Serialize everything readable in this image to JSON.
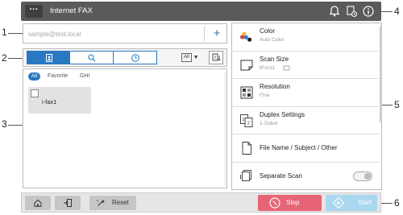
{
  "header": {
    "menu_label": "···",
    "title": "Internet FAX",
    "icons": [
      "bell-icon",
      "job-status-icon",
      "info-icon"
    ]
  },
  "address": {
    "placeholder": "sample@test.local",
    "add_label": "+"
  },
  "search_row": {
    "segments": [
      "address-book-icon",
      "search-icon",
      "history-icon"
    ],
    "filter_value": "All",
    "filter_caret": "▼"
  },
  "address_list": {
    "tabs": [
      "All",
      "Favorite",
      "GHI"
    ],
    "items": [
      {
        "name": "i-fax1"
      }
    ]
  },
  "settings": {
    "rows": [
      {
        "title": "Color",
        "subtitle": "Auto Color",
        "icon": "color-icon"
      },
      {
        "title": "Scan Size",
        "subtitle": "8½x11",
        "icon": "scan-size-icon"
      },
      {
        "title": "Resolution",
        "subtitle": "Fine",
        "icon": "resolution-icon"
      },
      {
        "title": "Duplex Settings",
        "subtitle": "1-Sided",
        "icon": "duplex-icon"
      },
      {
        "title": "File Name / Subject / Other",
        "icon": "document-icon"
      },
      {
        "title": "Separate Scan",
        "icon": "separate-scan-icon",
        "toggle": false
      }
    ]
  },
  "footer": {
    "reset_label": "Reset",
    "stop_label": "Stop",
    "start_label": "Start"
  },
  "callouts": [
    "1",
    "2",
    "3",
    "4",
    "5",
    "6"
  ],
  "colors": {
    "accent": "#2a78c2",
    "header_bg": "#5a5a5a",
    "stop": "#e76475",
    "start": "#a9d7ef"
  }
}
